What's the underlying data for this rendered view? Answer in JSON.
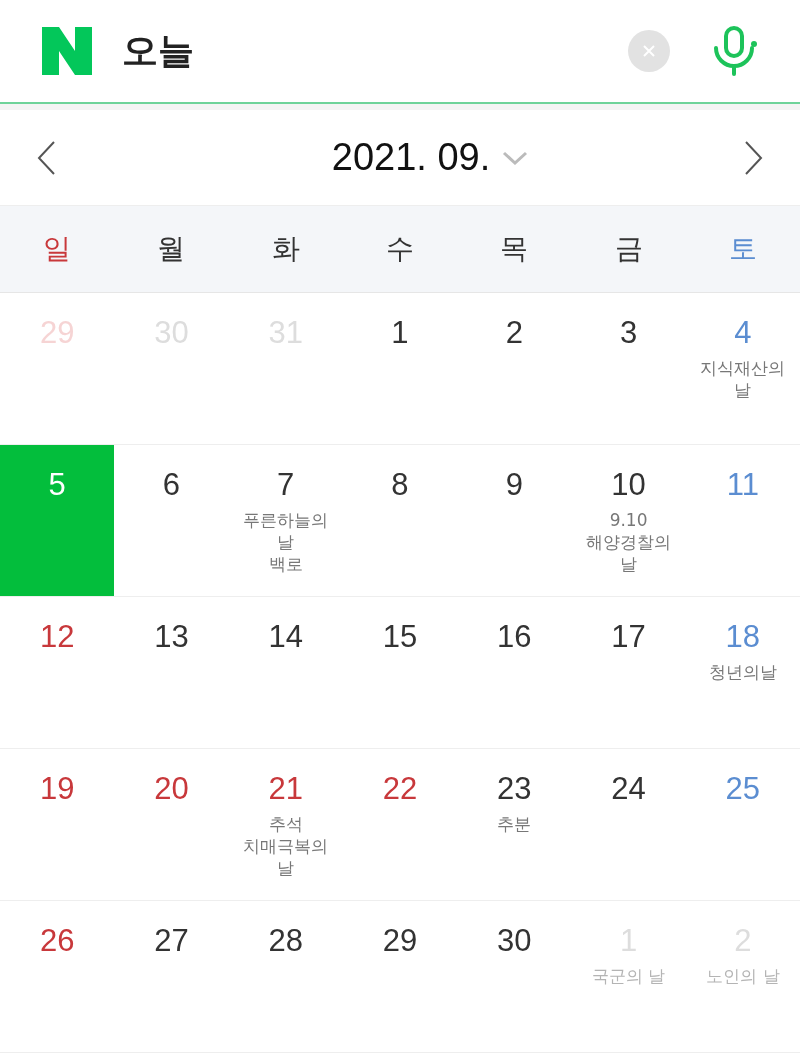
{
  "search": {
    "query": "오늘"
  },
  "calendar": {
    "month": "2021. 09.",
    "weekdays": [
      {
        "label": "일",
        "kind": "sunday"
      },
      {
        "label": "월",
        "kind": "weekday"
      },
      {
        "label": "화",
        "kind": "weekday"
      },
      {
        "label": "수",
        "kind": "weekday"
      },
      {
        "label": "목",
        "kind": "weekday"
      },
      {
        "label": "금",
        "kind": "weekday"
      },
      {
        "label": "토",
        "kind": "saturday"
      }
    ],
    "weeks": [
      [
        {
          "day": "29",
          "kind": "sunday",
          "other_month": true,
          "selected": false
        },
        {
          "day": "30",
          "kind": "weekday",
          "other_month": true,
          "selected": false
        },
        {
          "day": "31",
          "kind": "weekday",
          "other_month": true,
          "selected": false
        },
        {
          "day": "1",
          "kind": "weekday",
          "other_month": false,
          "selected": false
        },
        {
          "day": "2",
          "kind": "weekday",
          "other_month": false,
          "selected": false
        },
        {
          "day": "3",
          "kind": "weekday",
          "other_month": false,
          "selected": false
        },
        {
          "day": "4",
          "kind": "saturday",
          "other_month": false,
          "selected": false,
          "notes": [
            {
              "text": "지식재산의 날",
              "holiday": false
            }
          ]
        }
      ],
      [
        {
          "day": "5",
          "kind": "sunday",
          "other_month": false,
          "selected": true
        },
        {
          "day": "6",
          "kind": "weekday",
          "other_month": false,
          "selected": false
        },
        {
          "day": "7",
          "kind": "weekday",
          "other_month": false,
          "selected": false,
          "notes": [
            {
              "text": "푸른하늘의 날",
              "holiday": false
            },
            {
              "text": "백로",
              "holiday": false
            }
          ]
        },
        {
          "day": "8",
          "kind": "weekday",
          "other_month": false,
          "selected": false
        },
        {
          "day": "9",
          "kind": "weekday",
          "other_month": false,
          "selected": false
        },
        {
          "day": "10",
          "kind": "weekday",
          "other_month": false,
          "selected": false,
          "notes": [
            {
              "text": "9.10",
              "holiday": false
            },
            {
              "text": "해양경찰의 날",
              "holiday": false
            }
          ]
        },
        {
          "day": "11",
          "kind": "saturday",
          "other_month": false,
          "selected": false
        }
      ],
      [
        {
          "day": "12",
          "kind": "sunday",
          "other_month": false,
          "selected": false
        },
        {
          "day": "13",
          "kind": "weekday",
          "other_month": false,
          "selected": false
        },
        {
          "day": "14",
          "kind": "weekday",
          "other_month": false,
          "selected": false
        },
        {
          "day": "15",
          "kind": "weekday",
          "other_month": false,
          "selected": false
        },
        {
          "day": "16",
          "kind": "weekday",
          "other_month": false,
          "selected": false
        },
        {
          "day": "17",
          "kind": "weekday",
          "other_month": false,
          "selected": false
        },
        {
          "day": "18",
          "kind": "saturday",
          "other_month": false,
          "selected": false,
          "notes": [
            {
              "text": "청년의날",
              "holiday": false
            }
          ]
        }
      ],
      [
        {
          "day": "19",
          "kind": "sunday",
          "other_month": false,
          "selected": false
        },
        {
          "day": "20",
          "kind": "holiday",
          "other_month": false,
          "selected": false
        },
        {
          "day": "21",
          "kind": "holiday",
          "other_month": false,
          "selected": false,
          "notes": [
            {
              "text": "추석",
              "holiday": true
            },
            {
              "text": "치매극복의 날",
              "holiday": false
            }
          ]
        },
        {
          "day": "22",
          "kind": "holiday",
          "other_month": false,
          "selected": false
        },
        {
          "day": "23",
          "kind": "weekday",
          "other_month": false,
          "selected": false,
          "notes": [
            {
              "text": "추분",
              "holiday": false
            }
          ]
        },
        {
          "day": "24",
          "kind": "weekday",
          "other_month": false,
          "selected": false
        },
        {
          "day": "25",
          "kind": "saturday",
          "other_month": false,
          "selected": false
        }
      ],
      [
        {
          "day": "26",
          "kind": "sunday",
          "other_month": false,
          "selected": false
        },
        {
          "day": "27",
          "kind": "weekday",
          "other_month": false,
          "selected": false
        },
        {
          "day": "28",
          "kind": "weekday",
          "other_month": false,
          "selected": false
        },
        {
          "day": "29",
          "kind": "weekday",
          "other_month": false,
          "selected": false
        },
        {
          "day": "30",
          "kind": "weekday",
          "other_month": false,
          "selected": false
        },
        {
          "day": "1",
          "kind": "weekday",
          "other_month": true,
          "selected": false,
          "notes": [
            {
              "text": "국군의 날",
              "holiday": false
            }
          ]
        },
        {
          "day": "2",
          "kind": "saturday",
          "other_month": true,
          "selected": false,
          "notes": [
            {
              "text": "노인의 날",
              "holiday": false
            }
          ]
        }
      ]
    ]
  }
}
